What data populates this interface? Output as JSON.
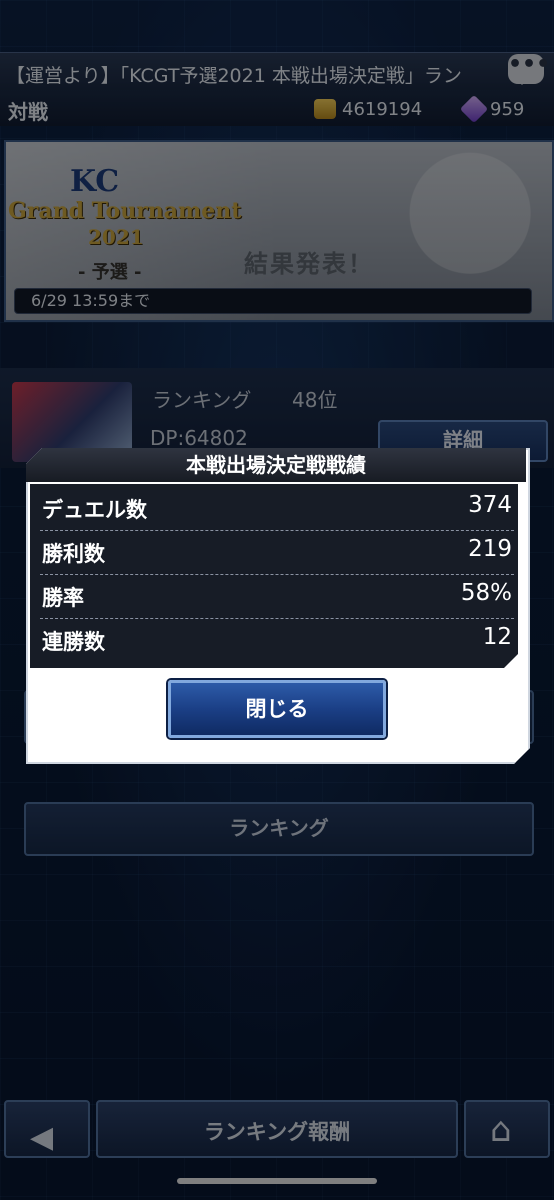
{
  "ticker": {
    "text": "【運営より】「KCGT予選2021 本戦出場決定戦」ラン"
  },
  "header": {
    "title": "対戦",
    "gold": "4619194",
    "gems": "959"
  },
  "banner": {
    "logo_kc": "KC",
    "logo_title": "Grand Tournament",
    "logo_year": "2021",
    "logo_sub": "- 予選 -",
    "result_text": "結果発表！",
    "deadline": "6/29 13:59まで"
  },
  "ranking_panel": {
    "rank_label": "ランキング",
    "rank_value": "48位",
    "dp_label": "DP:64802",
    "detail_button": "詳細"
  },
  "menu": {
    "ranking_button": "ランキング"
  },
  "modal": {
    "title": "本戦出場決定戦戦績",
    "stats": [
      {
        "label": "デュエル数",
        "value": "374"
      },
      {
        "label": "勝利数",
        "value": "219"
      },
      {
        "label": "勝率",
        "value": "58%"
      },
      {
        "label": "連勝数",
        "value": "12"
      }
    ],
    "close_button": "閉じる"
  },
  "bottom_nav": {
    "center_label": "ランキング報酬"
  },
  "icons": {
    "chat": "chat-bubble-icon",
    "back": "arrow-left-icon",
    "home": "home-icon",
    "gold": "gold-coin-icon",
    "gem": "gem-icon"
  }
}
